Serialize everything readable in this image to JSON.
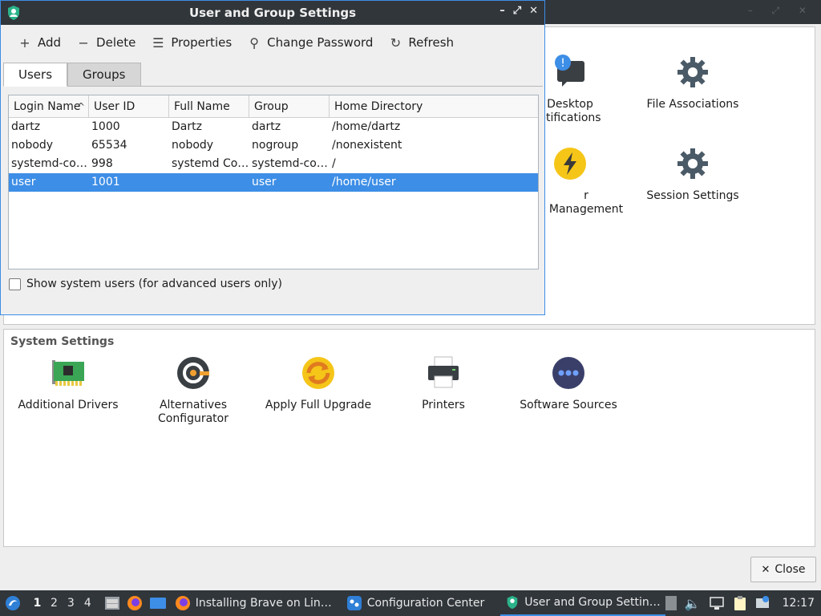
{
  "background": {
    "top_icons": [
      {
        "label": "Desktop\notifications",
        "line1": "Desktop",
        "line2": "otifications",
        "icon": "notification-bubble-icon"
      },
      {
        "label": "File Associations",
        "icon": "gear-icon"
      },
      {
        "label": "r Management",
        "icon": "power-lightning-icon"
      },
      {
        "label": "Session Settings",
        "icon": "gear-icon"
      }
    ],
    "system_settings": {
      "title": "System Settings",
      "items": [
        {
          "label": "Additional Drivers",
          "icon": "circuit-board-icon"
        },
        {
          "line1": "Alternatives",
          "line2": "Configurator",
          "icon": "alternatives-icon"
        },
        {
          "label": "Apply Full Upgrade",
          "icon": "upgrade-icon"
        },
        {
          "label": "Printers",
          "icon": "printer-icon"
        },
        {
          "label": "Software Sources",
          "icon": "software-sources-icon"
        }
      ]
    },
    "close_button": "Close"
  },
  "dialog": {
    "title": "User and Group Settings",
    "toolbar": {
      "add": "Add",
      "delete": "Delete",
      "properties": "Properties",
      "change_password": "Change Password",
      "refresh": "Refresh"
    },
    "tabs": [
      {
        "label": "Users",
        "active": true
      },
      {
        "label": "Groups",
        "active": false
      }
    ],
    "table": {
      "columns": [
        "Login Name",
        "User ID",
        "Full Name",
        "Group",
        "Home Directory"
      ],
      "rows": [
        [
          "dartz",
          "1000",
          "Dartz",
          "dartz",
          "/home/dartz"
        ],
        [
          "nobody",
          "65534",
          "nobody",
          "nogroup",
          "/nonexistent"
        ],
        [
          "systemd-co…",
          "998",
          "systemd Co…",
          "systemd-co…",
          "/"
        ],
        [
          "user",
          "1001",
          "",
          "user",
          "/home/user"
        ]
      ],
      "selected_row": 3
    },
    "show_system_users": "Show system users (for advanced users only)"
  },
  "taskbar": {
    "workspaces": [
      "1",
      "2",
      "3",
      "4"
    ],
    "tasks": [
      {
        "label": "Installing Brave on Lin…",
        "icon": "firefox-icon"
      },
      {
        "label": "Configuration Center",
        "icon": "config-center-icon"
      },
      {
        "label": "User and Group Settin…",
        "icon": "user-group-icon"
      }
    ],
    "clock": "12:17"
  },
  "colors": {
    "accent": "#3d8ee6",
    "titlebar": "#31363b"
  }
}
